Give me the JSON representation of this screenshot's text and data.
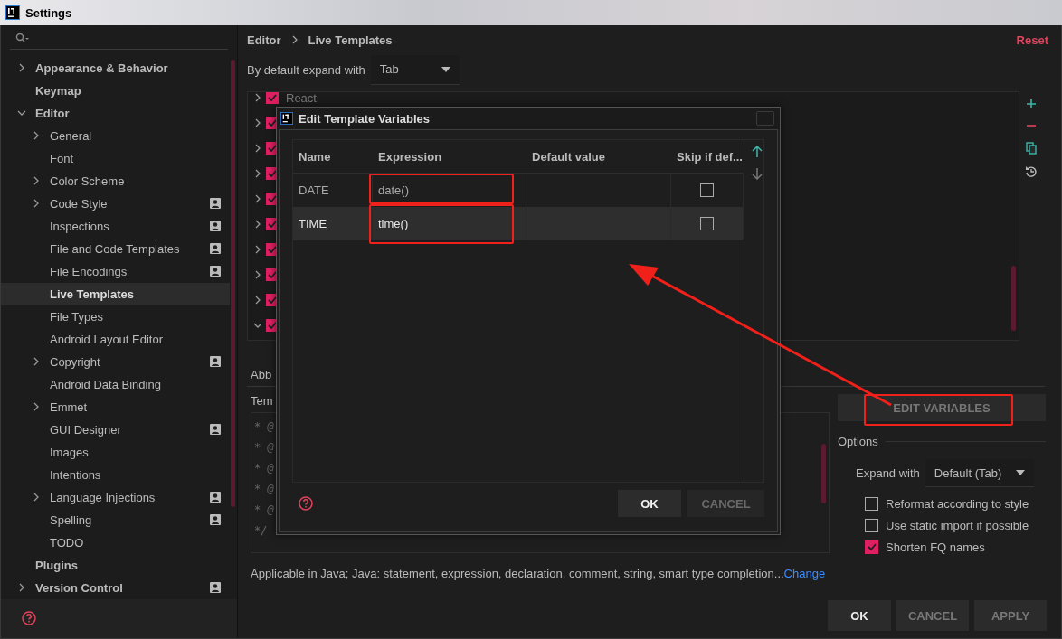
{
  "window": {
    "title": "Settings"
  },
  "sidebar": {
    "items": [
      {
        "label": "Appearance & Behavior",
        "selected": false,
        "expanded": false,
        "per_project": false
      },
      {
        "label": "Keymap",
        "selected": false,
        "per_project": false
      },
      {
        "label": "Editor",
        "selected": false,
        "expanded": true,
        "per_project": false,
        "children": [
          {
            "label": "General",
            "selected": false,
            "expanded": false,
            "per_project": false
          },
          {
            "label": "Font",
            "selected": false,
            "per_project": false
          },
          {
            "label": "Color Scheme",
            "selected": false,
            "expanded": false,
            "per_project": false
          },
          {
            "label": "Code Style",
            "selected": false,
            "expanded": false,
            "per_project": true
          },
          {
            "label": "Inspections",
            "selected": false,
            "per_project": true
          },
          {
            "label": "File and Code Templates",
            "selected": false,
            "per_project": true
          },
          {
            "label": "File Encodings",
            "selected": false,
            "per_project": true
          },
          {
            "label": "Live Templates",
            "selected": true,
            "per_project": false
          },
          {
            "label": "File Types",
            "selected": false,
            "per_project": false
          },
          {
            "label": "Android Layout Editor",
            "selected": false,
            "per_project": false
          },
          {
            "label": "Copyright",
            "selected": false,
            "expanded": false,
            "per_project": true
          },
          {
            "label": "Android Data Binding",
            "selected": false,
            "per_project": false
          },
          {
            "label": "Emmet",
            "selected": false,
            "expanded": false,
            "per_project": false
          },
          {
            "label": "GUI Designer",
            "selected": false,
            "per_project": true
          },
          {
            "label": "Images",
            "selected": false,
            "per_project": false
          },
          {
            "label": "Intentions",
            "selected": false,
            "per_project": false
          },
          {
            "label": "Language Injections",
            "selected": false,
            "expanded": false,
            "per_project": true
          },
          {
            "label": "Spelling",
            "selected": false,
            "per_project": true
          },
          {
            "label": "TODO",
            "selected": false,
            "per_project": false
          }
        ]
      },
      {
        "label": "Plugins",
        "selected": false,
        "per_project": false
      },
      {
        "label": "Version Control",
        "selected": false,
        "expanded": false,
        "per_project": true
      }
    ]
  },
  "breadcrumb": [
    "Editor",
    "Live Templates"
  ],
  "reset_link": "Reset",
  "expand_default": {
    "label": "By default expand with",
    "value": "Tab"
  },
  "template_groups": [
    {
      "name": "React",
      "expanded": false,
      "checked": true
    },
    {
      "expanded": false,
      "checked": true
    },
    {
      "expanded": false,
      "checked": true
    },
    {
      "expanded": false,
      "checked": true
    },
    {
      "expanded": false,
      "checked": true
    },
    {
      "expanded": false,
      "checked": true
    },
    {
      "expanded": false,
      "checked": true
    },
    {
      "expanded": false,
      "checked": true
    },
    {
      "expanded": false,
      "checked": true
    },
    {
      "expanded": true,
      "checked": true
    }
  ],
  "abbreviation_label": "Abb",
  "template_text_label": "Tem",
  "template_text": [
    "* @",
    "* @",
    "* @",
    "* @",
    "* @",
    "*/"
  ],
  "edit_variables_button": "EDIT VARIABLES",
  "options": {
    "title": "Options",
    "expand_label": "Expand with",
    "expand_value": "Default (Tab)",
    "checkboxes": [
      {
        "label": "Reformat according to style",
        "checked": false
      },
      {
        "label": "Use static import if possible",
        "checked": false
      },
      {
        "label": "Shorten FQ names",
        "checked": true
      }
    ]
  },
  "applicable": {
    "text": "Applicable in Java; Java: statement, expression, declaration, comment, string, smart type completion...",
    "link": "Change"
  },
  "buttons": [
    {
      "label": "OK",
      "default": true
    },
    {
      "label": "CANCEL",
      "default": false
    },
    {
      "label": "APPLY",
      "default": false
    }
  ],
  "dialog": {
    "title": "Edit Template Variables",
    "columns": [
      "Name",
      "Expression",
      "Default value",
      "Skip if def..."
    ],
    "rows": [
      {
        "name": "DATE",
        "expression": "date()",
        "skip_if_defined": false,
        "selected": false
      },
      {
        "name": "TIME",
        "expression": "time()",
        "skip_if_defined": false,
        "selected": true
      }
    ],
    "buttons": [
      {
        "label": "OK",
        "disabled": false
      },
      {
        "label": "CANCEL",
        "disabled": true
      }
    ]
  }
}
